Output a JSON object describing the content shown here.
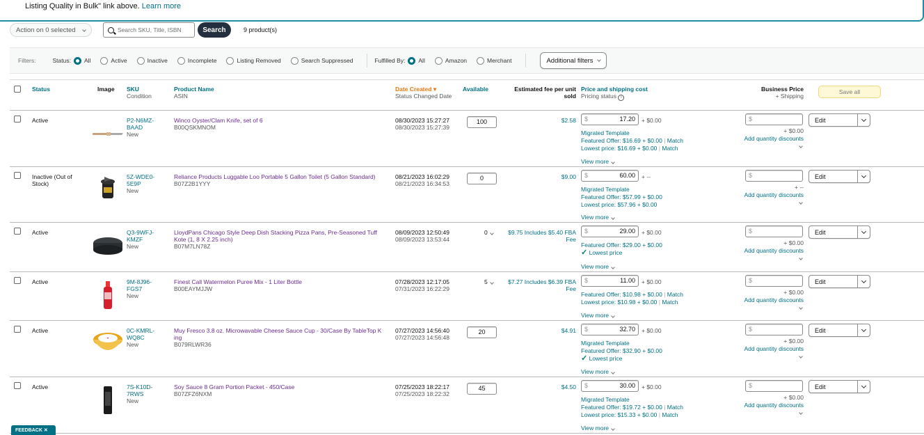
{
  "banner": {
    "text": "Listing Quality in Bulk\" link above.",
    "link": "Learn more"
  },
  "toolbar": {
    "action": "Action on 0 selected",
    "search_placeholder": "Search SKU, Title, ISBN",
    "search_btn": "Search",
    "count": "9 product(s)"
  },
  "filters": {
    "label": "Filters:",
    "status_label": "Status:",
    "status_opts": [
      "All",
      "Active",
      "Inactive",
      "Incomplete",
      "Listing Removed",
      "Search Suppressed"
    ],
    "fulfilled_label": "Fulfilled By:",
    "fulfilled_opts": [
      "All",
      "Amazon",
      "Merchant"
    ],
    "additional": "Additional filters"
  },
  "header": {
    "status": "Status",
    "image": "Image",
    "sku": "SKU",
    "condition": "Condition",
    "product": "Product Name",
    "asin": "ASIN",
    "date_created": "Date Created",
    "status_changed": "Status Changed Date",
    "available": "Available",
    "fee1": "Estimated fee per unit",
    "fee2": "sold",
    "price": "Price and shipping cost",
    "pricing_status": "Pricing status",
    "business1": "Business Price",
    "business2": "+ Shipping",
    "save_all": "Save all"
  },
  "rows": [
    {
      "status": "Active",
      "sku1": "P2-N6MZ-",
      "sku2": "BAAD",
      "cond": "New",
      "name": "Winco Oyster/Clam Knife, set of 6",
      "name2": "",
      "asin": "B00QSKMNOM",
      "d1": "08/30/2023 15:27:27",
      "d2": "08/30/2023 15:27:39",
      "qty": "100",
      "fee": "$2.58",
      "fee2": "",
      "price": "17.20",
      "ship": "+ $0.00",
      "l1": "Migrated Template",
      "l2": "Featured Offer: $16.69 + $0.00",
      "l2m": "Match",
      "l3": "Lowest price: $16.69 + $0.00",
      "l3m": "Match",
      "bship": "+ $0.00",
      "disc": "Add quantity discounts",
      "vm": "View more",
      "edit": "Edit"
    },
    {
      "status": "Inactive (Out of",
      "status2": "Stock)",
      "sku1": "5Z-WDE0-",
      "sku2": "5E9P",
      "cond": "New",
      "name": "Reliance Products Luggable Loo Portable 5 Gallon Toilet (5 Gallon Standard)",
      "name2": "",
      "asin": "B07Z2B1YYY",
      "d1": "08/21/2023 16:02:29",
      "d2": "08/21/2023 16:34:53",
      "qty": "0",
      "fee": "$9.00",
      "fee2": "",
      "price": "60.00",
      "ship": "+ --",
      "l1": "Migrated Template",
      "l2": "Featured Offer: $57.99 + $0.00",
      "l2m": "",
      "l3": "Lowest price: $57.96 + $0.00",
      "l3m": "",
      "bship": "+ --",
      "disc": "Add quantity discounts",
      "vm": "View more",
      "edit": "Edit"
    },
    {
      "status": "Active",
      "sku1": "Q3-9WFJ-",
      "sku2": "KMZF",
      "cond": "New",
      "name": "LloydPans Chicago Style Deep Dish Stacking Pizza Pans, Pre-Seasoned Tuff",
      "name2": "Kote (1, 8 X 2.25 inch)",
      "asin": "B07M7LN78Z",
      "d1": "08/09/2023 12:50:49",
      "d2": "08/09/2023 13:53:44",
      "qty": "0",
      "fee": "$9.75 Includes $5.40 FBA",
      "fee2": "Fee",
      "price": "29.00",
      "ship": "+ $0.00",
      "l1": "Featured Offer: $29.00 + $0.00",
      "l2": "Lowest price",
      "l2m": "",
      "l3": "",
      "l3m": "",
      "bship": "+ $0.00",
      "disc": "Add quantity discounts",
      "vm": "View more",
      "edit": "Edit"
    },
    {
      "status": "Active",
      "sku1": "9M-8J96-",
      "sku2": "FGS7",
      "cond": "New",
      "name": "Finest Call Watermelon Puree Mix - 1 Liter Bottle",
      "name2": "",
      "asin": "B00EAYMJJW",
      "d1": "07/28/2023 12:17:05",
      "d2": "07/31/2023 16:22:29",
      "qty": "5",
      "fee": "$7.27 Includes $6.39 FBA",
      "fee2": "Fee",
      "price": "11.00",
      "ship": "+ $0.00",
      "l1": "Featured Offer: $10.98 + $0.00",
      "l2": "Lowest price: $10.98 + $0.00",
      "l2m": "Match",
      "l3": "",
      "l3m": "",
      "l1m": "Match",
      "bship": "+ $0.00",
      "disc": "Add quantity discounts",
      "vm": "View more",
      "edit": "Edit"
    },
    {
      "status": "Active",
      "sku1": "0C-KMRL-",
      "sku2": "WQ8C",
      "cond": "New",
      "name": "Muy Fresco 3.8 oz. Microwavable Cheese Sauce Cup - 30/Case By TableTop K",
      "name2": "ing",
      "asin": "B079RLWR36",
      "d1": "07/27/2023 14:56:40",
      "d2": "07/27/2023 14:56:48",
      "qty": "20",
      "fee": "$4.91",
      "fee2": "",
      "price": "32.70",
      "ship": "+ $0.00",
      "l1": "Migrated Template",
      "l2": "Featured Offer: $32.90 + $0.00",
      "l2m": "",
      "l3": "Lowest price",
      "l3m": "",
      "bship": "+ $0.00",
      "disc": "Add quantity discounts",
      "vm": "View more",
      "edit": "Edit"
    },
    {
      "status": "Active",
      "sku1": "7S-K10D-",
      "sku2": "7RWS",
      "cond": "New",
      "name": "Soy Sauce 8 Gram Portion Packet - 450/Case",
      "name2": "",
      "asin": "B07ZFZ6NXM",
      "d1": "07/25/2023 18:22:17",
      "d2": "07/25/2023 18:22:32",
      "qty": "45",
      "fee": "$4.50",
      "fee2": "",
      "price": "30.00",
      "ship": "+ $0.00",
      "l1": "Migrated Template",
      "l2": "Featured Offer: $19.72 + $0.00",
      "l2m": "Match",
      "l3": "Lowest price: $15.33 + $0.00",
      "l3m": "Match",
      "bship": "+ $0.00",
      "disc": "Add quantity discounts",
      "vm": "View more",
      "edit": "Edit"
    }
  ],
  "currency": "$",
  "feedback": "FEEDBACK"
}
